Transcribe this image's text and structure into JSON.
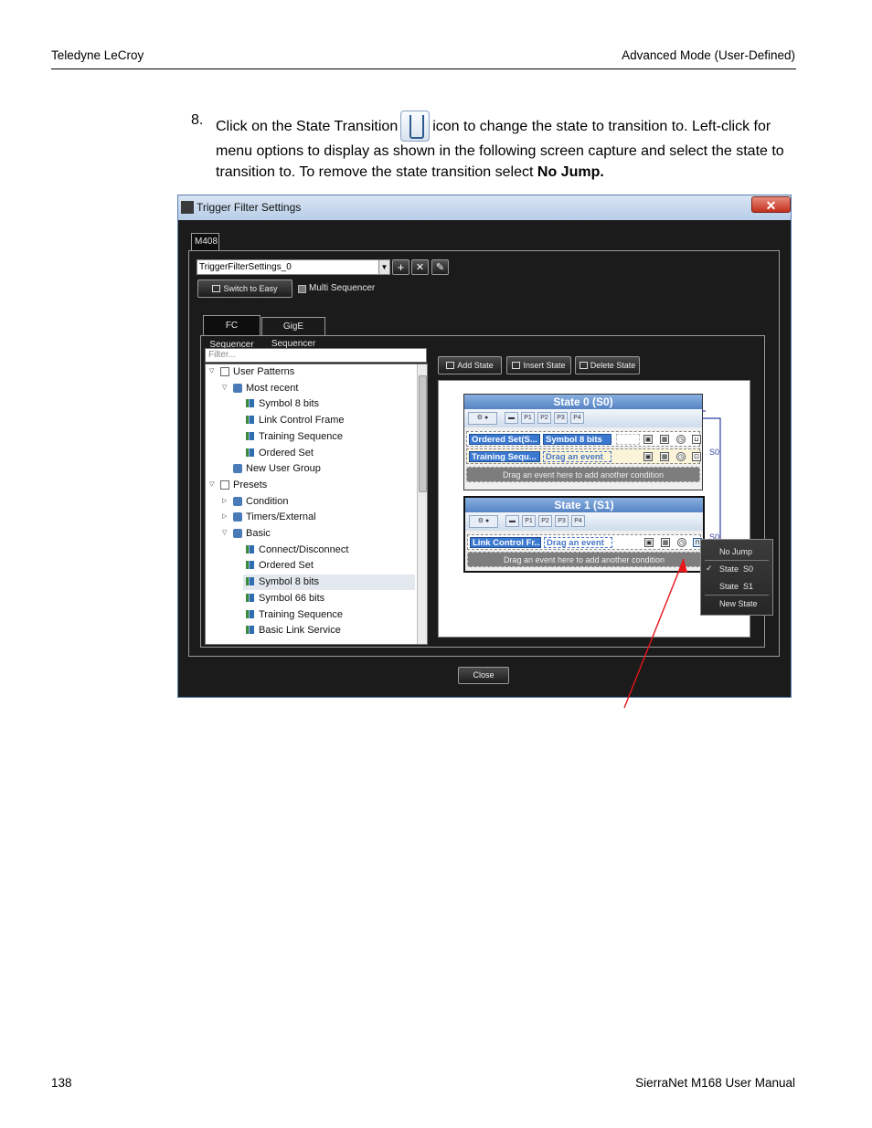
{
  "header": {
    "left": "Teledyne LeCroy",
    "right": "Advanced Mode (User-Defined)"
  },
  "footer": {
    "page": "138",
    "manual": "SierraNet M168 User Manual"
  },
  "step": {
    "number": "8.",
    "text_before": "Click on the State Transition",
    "text_after": "icon to change the state to transition to. Left-click for menu options to display as shown in the following screen capture and select the state to transition to. To remove the state transition select",
    "bold": "No Jump.",
    "icon": "state-transition-icon"
  },
  "window": {
    "title": "Trigger Filter Settings",
    "close_glyph": "✕",
    "device_tab": "M408",
    "settings_combo": "TriggerFilterSettings_0",
    "add_glyph": "+",
    "delete_glyph": "✕",
    "edit_glyph": "✎",
    "switch_btn": "Switch to Easy",
    "multi_seq": "Multi Sequencer",
    "tabs": [
      "FC Sequencer",
      "GigE Sequencer"
    ],
    "filter_placeholder": "Filter...",
    "tree": [
      {
        "label": "User Patterns",
        "level": 0,
        "expanded": true,
        "icon": "user-patterns-icon"
      },
      {
        "label": "Most recent",
        "level": 1,
        "expanded": true,
        "icon": "group-icon"
      },
      {
        "label": "Symbol 8 bits",
        "level": 2,
        "icon": "pattern-icon"
      },
      {
        "label": "Link Control Frame",
        "level": 2,
        "icon": "pattern-icon"
      },
      {
        "label": "Training Sequence",
        "level": 2,
        "icon": "pattern-icon"
      },
      {
        "label": "Ordered Set",
        "level": 2,
        "icon": "pattern-icon"
      },
      {
        "label": "New User Group",
        "level": 1,
        "icon": "group-icon"
      },
      {
        "label": "Presets",
        "level": 0,
        "expanded": true,
        "icon": "presets-icon"
      },
      {
        "label": "Condition",
        "level": 1,
        "expanded": false,
        "icon": "group-icon"
      },
      {
        "label": "Timers/External",
        "level": 1,
        "expanded": false,
        "icon": "group-icon"
      },
      {
        "label": "Basic",
        "level": 1,
        "expanded": true,
        "icon": "group-icon"
      },
      {
        "label": "Connect/Disconnect",
        "level": 2,
        "icon": "pattern-icon"
      },
      {
        "label": "Ordered Set",
        "level": 2,
        "icon": "pattern-icon"
      },
      {
        "label": "Symbol 8 bits",
        "level": 2,
        "icon": "pattern-icon",
        "selected": true
      },
      {
        "label": "Symbol 66 bits",
        "level": 2,
        "icon": "pattern-icon"
      },
      {
        "label": "Training Sequence",
        "level": 2,
        "icon": "pattern-icon"
      },
      {
        "label": "Basic Link Service",
        "level": 2,
        "icon": "pattern-icon"
      }
    ],
    "toolbar": {
      "add_state": "Add State",
      "insert_state": "Insert State",
      "delete_state": "Delete State"
    },
    "ports": [
      "P1",
      "P2",
      "P3",
      "P4"
    ],
    "states": [
      {
        "title": "State 0 (S0)",
        "rows": [
          {
            "chip1": "Ordered Set(S...",
            "chip2": "Symbol 8 bits"
          },
          {
            "chip1": "Training Sequ...",
            "chip2": "Drag an event"
          }
        ],
        "drag": "Drag an event here to add another condition",
        "jump_label": "S0"
      },
      {
        "title": "State 1 (S1)",
        "rows": [
          {
            "chip1": "Link Control Fr...",
            "chip2": "Drag an event"
          }
        ],
        "drag": "Drag an event here to add another condition",
        "jump_label": "S0"
      }
    ],
    "context_menu": {
      "items": [
        "No Jump",
        "State  S0",
        "State  S1",
        "New State"
      ],
      "checked": "✓"
    },
    "close_btn": "Close"
  }
}
